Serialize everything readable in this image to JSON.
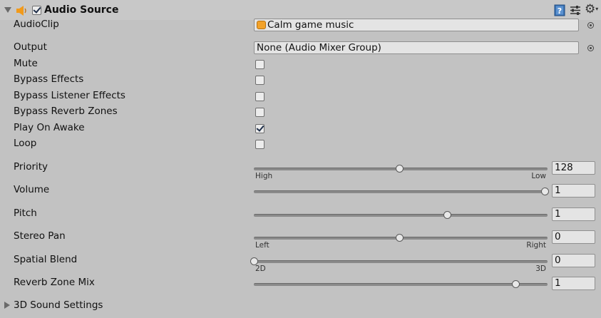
{
  "header": {
    "title": "Audio Source",
    "enabled": true
  },
  "fields": {
    "audioclip": {
      "label": "AudioClip",
      "value": "Calm game music"
    },
    "output": {
      "label": "Output",
      "value": "None (Audio Mixer Group)"
    }
  },
  "toggles": [
    {
      "label": "Mute",
      "checked": false
    },
    {
      "label": "Bypass Effects",
      "checked": false
    },
    {
      "label": "Bypass Listener Effects",
      "checked": false
    },
    {
      "label": "Bypass Reverb Zones",
      "checked": false
    },
    {
      "label": "Play On Awake",
      "checked": true
    },
    {
      "label": "Loop",
      "checked": false
    }
  ],
  "sliders": [
    {
      "label": "Priority",
      "value": "128",
      "fraction": 0.5,
      "min_label": "High",
      "max_label": "Low"
    },
    {
      "label": "Volume",
      "value": "1",
      "fraction": 1.0,
      "min_label": "",
      "max_label": ""
    },
    {
      "label": "Pitch",
      "value": "1",
      "fraction": 0.663,
      "min_label": "",
      "max_label": ""
    },
    {
      "label": "Stereo Pan",
      "value": "0",
      "fraction": 0.5,
      "min_label": "Left",
      "max_label": "Right"
    },
    {
      "label": "Spatial Blend",
      "value": "0",
      "fraction": 0.0,
      "min_label": "2D",
      "max_label": "3D"
    },
    {
      "label": "Reverb Zone Mix",
      "value": "1",
      "fraction": 0.9,
      "min_label": "",
      "max_label": ""
    }
  ],
  "footer": {
    "label": "3D Sound Settings"
  },
  "colors": {
    "background": "#c2c2c2",
    "speaker": "#f29a1a",
    "help_icon": "#3a73b5"
  },
  "icons": [
    "foldout-arrow-icon",
    "speaker-icon",
    "help-book-icon",
    "preset-sliders-icon",
    "gear-icon",
    "audio-clip-icon",
    "object-picker-icon"
  ]
}
